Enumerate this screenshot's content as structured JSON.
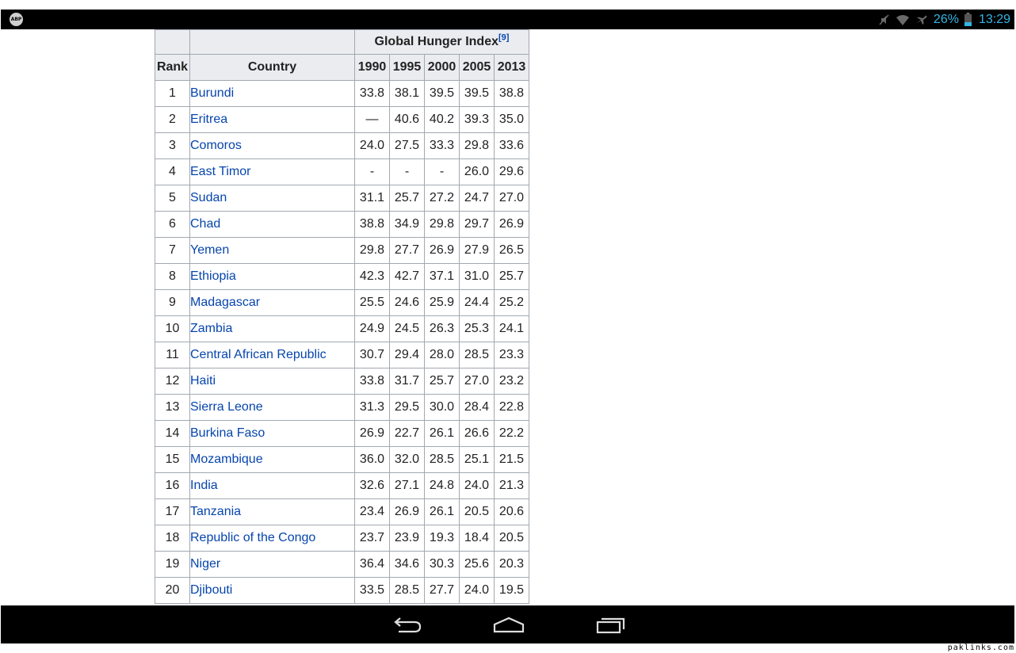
{
  "status_bar": {
    "left_icon": "ABP",
    "icons": [
      "mute-icon",
      "wifi-icon",
      "airplane-mode-icon",
      "battery-icon"
    ],
    "battery_percent": "26%",
    "time": "13:29",
    "accent_color": "#33b5e5"
  },
  "table": {
    "group_header": "Global Hunger Index",
    "group_header_ref": "[9]",
    "columns": {
      "rank": "Rank",
      "country": "Country",
      "years": [
        "1990",
        "1995",
        "2000",
        "2005",
        "2013"
      ]
    },
    "rows": [
      {
        "rank": "1",
        "country": "Burundi",
        "v": [
          "33.8",
          "38.1",
          "39.5",
          "39.5",
          "38.8"
        ]
      },
      {
        "rank": "2",
        "country": "Eritrea",
        "v": [
          "—",
          "40.6",
          "40.2",
          "39.3",
          "35.0"
        ]
      },
      {
        "rank": "3",
        "country": "Comoros",
        "v": [
          "24.0",
          "27.5",
          "33.3",
          "29.8",
          "33.6"
        ]
      },
      {
        "rank": "4",
        "country": "East Timor",
        "v": [
          "-",
          "-",
          "-",
          "26.0",
          "29.6"
        ]
      },
      {
        "rank": "5",
        "country": "Sudan",
        "v": [
          "31.1",
          "25.7",
          "27.2",
          "24.7",
          "27.0"
        ]
      },
      {
        "rank": "6",
        "country": "Chad",
        "v": [
          "38.8",
          "34.9",
          "29.8",
          "29.7",
          "26.9"
        ]
      },
      {
        "rank": "7",
        "country": "Yemen",
        "v": [
          "29.8",
          "27.7",
          "26.9",
          "27.9",
          "26.5"
        ]
      },
      {
        "rank": "8",
        "country": "Ethiopia",
        "v": [
          "42.3",
          "42.7",
          "37.1",
          "31.0",
          "25.7"
        ]
      },
      {
        "rank": "9",
        "country": "Madagascar",
        "v": [
          "25.5",
          "24.6",
          "25.9",
          "24.4",
          "25.2"
        ]
      },
      {
        "rank": "10",
        "country": "Zambia",
        "v": [
          "24.9",
          "24.5",
          "26.3",
          "25.3",
          "24.1"
        ]
      },
      {
        "rank": "11",
        "country": "Central African Republic",
        "v": [
          "30.7",
          "29.4",
          "28.0",
          "28.5",
          "23.3"
        ]
      },
      {
        "rank": "12",
        "country": "Haiti",
        "v": [
          "33.8",
          "31.7",
          "25.7",
          "27.0",
          "23.2"
        ]
      },
      {
        "rank": "13",
        "country": "Sierra Leone",
        "v": [
          "31.3",
          "29.5",
          "30.0",
          "28.4",
          "22.8"
        ]
      },
      {
        "rank": "14",
        "country": "Burkina Faso",
        "v": [
          "26.9",
          "22.7",
          "26.1",
          "26.6",
          "22.2"
        ]
      },
      {
        "rank": "15",
        "country": "Mozambique",
        "v": [
          "36.0",
          "32.0",
          "28.5",
          "25.1",
          "21.5"
        ]
      },
      {
        "rank": "16",
        "country": "India",
        "v": [
          "32.6",
          "27.1",
          "24.8",
          "24.0",
          "21.3"
        ]
      },
      {
        "rank": "17",
        "country": "Tanzania",
        "v": [
          "23.4",
          "26.9",
          "26.1",
          "20.5",
          "20.6"
        ]
      },
      {
        "rank": "18",
        "country": "Republic of the Congo",
        "v": [
          "23.7",
          "23.9",
          "19.3",
          "18.4",
          "20.5"
        ]
      },
      {
        "rank": "19",
        "country": "Niger",
        "v": [
          "36.4",
          "34.6",
          "30.3",
          "25.6",
          "20.3"
        ]
      },
      {
        "rank": "20",
        "country": "Djibouti",
        "v": [
          "33.5",
          "28.5",
          "27.7",
          "24.0",
          "19.5"
        ]
      }
    ],
    "link_color": "#0645ad",
    "header_bg": "#eaecf0",
    "border_color": "#a2a9b1"
  },
  "nav_bar": {
    "buttons": [
      "back-icon",
      "home-icon",
      "recents-icon"
    ]
  },
  "watermark": "paklinks.com"
}
